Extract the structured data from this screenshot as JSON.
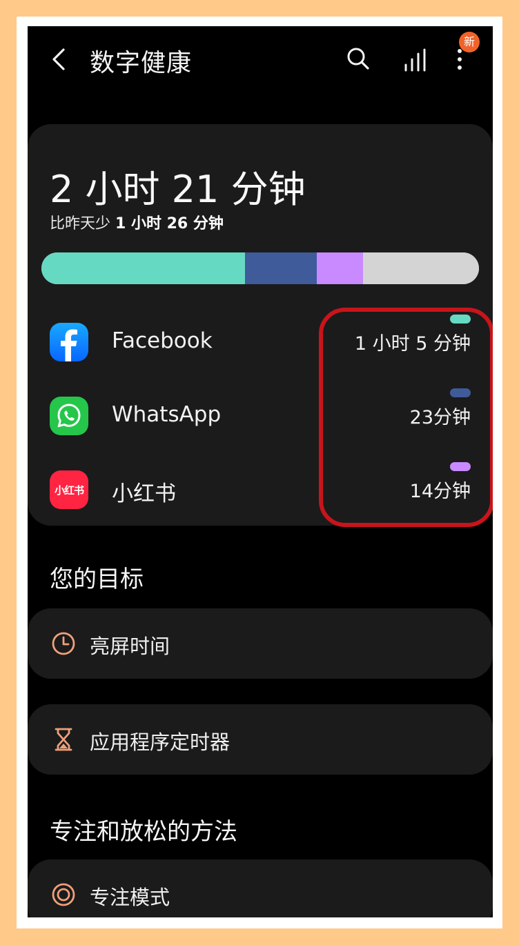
{
  "header": {
    "title": "数字健康",
    "badge": "新"
  },
  "summary": {
    "total_time": "2 小时 21 分钟",
    "compare_prefix": "比昨天少 ",
    "compare_value": "1 小时 26 分钟"
  },
  "usage_bar": [
    {
      "app": "Facebook",
      "color": "#66d9c3",
      "fraction": 0.465
    },
    {
      "app": "WhatsApp",
      "color": "#3f5b9a",
      "fraction": 0.165
    },
    {
      "app": "小红书",
      "color": "#c98aff",
      "fraction": 0.105
    },
    {
      "app": "other",
      "color": "#d4d4d4",
      "fraction": 0.265
    }
  ],
  "apps": [
    {
      "name": "Facebook",
      "time": "1 小时 5 分钟",
      "color": "#66d9c3",
      "icon": "facebook-icon"
    },
    {
      "name": "WhatsApp",
      "time": "23分钟",
      "color": "#3f5b9a",
      "icon": "whatsapp-icon"
    },
    {
      "name": "小红书",
      "time": "14分钟",
      "color": "#c98aff",
      "icon": "xiaohongshu-icon",
      "icon_text": "小红书"
    }
  ],
  "goals": {
    "heading": "您的目标",
    "items": [
      {
        "label": "亮屏时间",
        "icon": "clock-icon"
      },
      {
        "label": "应用程序定时器",
        "icon": "hourglass-icon"
      }
    ]
  },
  "focus": {
    "heading": "专注和放松的方法",
    "items": [
      {
        "label": "专注模式",
        "icon": "focus-target-icon"
      }
    ]
  },
  "colors": {
    "accent_icon": "#f0a07a",
    "highlight": "#c8141b"
  }
}
